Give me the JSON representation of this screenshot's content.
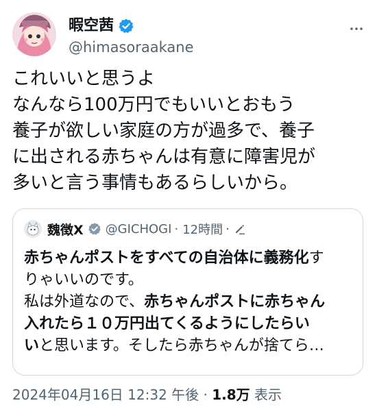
{
  "author": {
    "display_name": "暇空茜",
    "handle": "@himasoraakane",
    "verified_color": "#1d9bf0"
  },
  "post": {
    "lines": [
      "これいいと思うよ",
      "なんなら100万円でもいいとおもう",
      "養子が欲しい家庭の方が過多で、養子",
      "に出される赤ちゃんは有意に障害児が",
      "多いと言う事情もあるらしいから。"
    ]
  },
  "quoted": {
    "display_name": "魏徴X",
    "handle": "@GICHOGI",
    "separator": "·",
    "time": "12時間",
    "badge_color": "#829aab",
    "lines": [
      [
        {
          "text": "赤ちゃんポストをすべての自治体に義務化",
          "bold": true
        },
        {
          "text": "す",
          "bold": false
        }
      ],
      [
        {
          "text": "りゃいいのです。",
          "bold": false
        }
      ],
      [
        {
          "text": "私は外道なので、",
          "bold": false
        },
        {
          "text": "赤ちゃんポストに赤ちゃん",
          "bold": true
        }
      ],
      [
        {
          "text": "入れたら１０万円出てくるようにしたらい",
          "bold": true
        }
      ],
      [
        {
          "text": "い",
          "bold": true
        },
        {
          "text": "と思います。そしたら赤ちゃんが捨てら…",
          "bold": false
        }
      ]
    ]
  },
  "footer": {
    "timestamp": "2024年04月16日 12:32 午後",
    "separator": "·",
    "views_count": "1.8万",
    "views_label": "表示"
  }
}
